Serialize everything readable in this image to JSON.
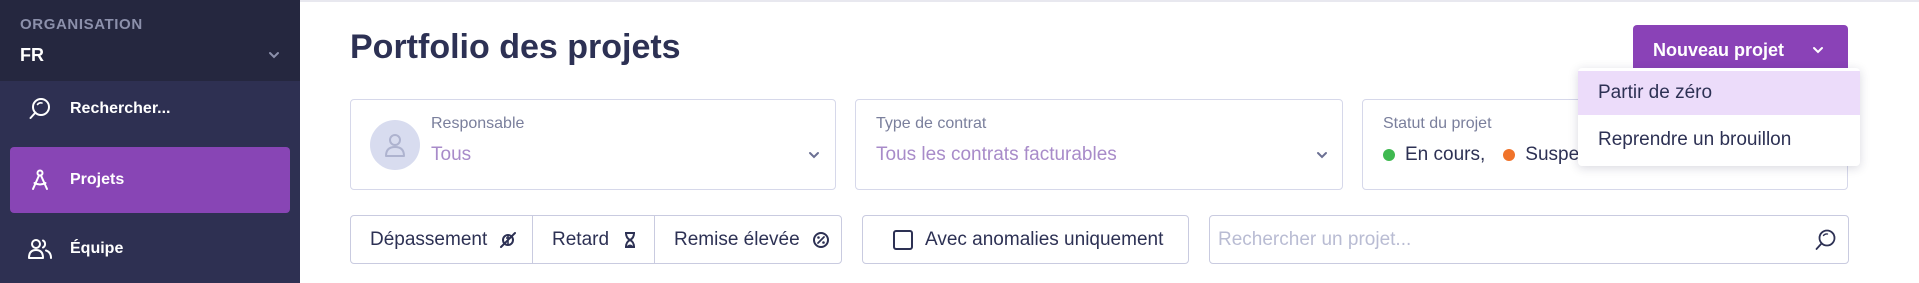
{
  "sidebar": {
    "org_label": "ORGANISATION",
    "org_value": "FR",
    "items": [
      {
        "label": "Rechercher...",
        "icon": "search-icon"
      },
      {
        "label": "Projets",
        "icon": "compass-icon",
        "active": true
      },
      {
        "label": "Équipe",
        "icon": "users-icon"
      }
    ]
  },
  "main": {
    "title": "Portfolio des projets",
    "new_button": "Nouveau projet",
    "new_menu": [
      "Partir de zéro",
      "Reprendre un brouillon"
    ],
    "filters": {
      "responsible": {
        "label": "Responsable",
        "value": "Tous"
      },
      "contract": {
        "label": "Type de contrat",
        "value": "Tous les contrats facturables"
      },
      "status": {
        "label": "Statut du projet",
        "tags": [
          {
            "label": "En cours,",
            "color": "#3fb950"
          },
          {
            "label": "Suspen",
            "color": "#f0732a"
          }
        ]
      }
    },
    "toggles": [
      {
        "label": "Dépassement",
        "icon": "no-money-icon"
      },
      {
        "label": "Retard",
        "icon": "hourglass-icon"
      },
      {
        "label": "Remise élevée",
        "icon": "discount-icon"
      }
    ],
    "anomalies_label": "Avec anomalies uniquement",
    "search_placeholder": "Rechercher un projet..."
  },
  "colors": {
    "sidebar_bg": "#2e3052",
    "accent": "#8a42b7",
    "menu_highlight": "#ecdcfa"
  }
}
